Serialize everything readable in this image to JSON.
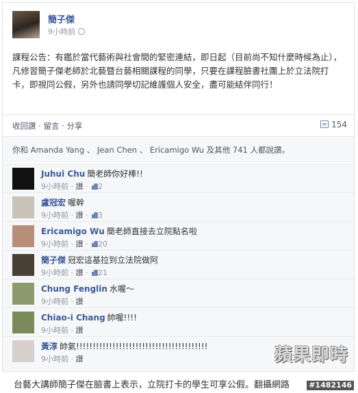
{
  "post": {
    "author": "簡子傑",
    "time": "9小時前",
    "text": "課程公告：有鑑於當代藝術與社會間的緊密連結，即日起（目前尚不知什麼時候為止），凡修習簡子傑老師於北藝暨台藝相關課程的同學，只要在課程臉書社團上於立法院打卡，即視同公假，另外也請同學切記維護個人安全，盡可能結伴同行！"
  },
  "actions": {
    "like": "收回讚",
    "comment": "留言",
    "share": "分享",
    "separator": " · ",
    "share_count": "154"
  },
  "likes": {
    "text": "你和 Amanda Yang 、 Jean Chen 、 Ericamigo Wu 及其他 741 人都說讚。"
  },
  "comments": [
    {
      "name": "Juhui Chu",
      "text": "簡老師你好棒!!",
      "time": "9小時前",
      "like": "讚",
      "likes": "2",
      "avatar_color": "#111111"
    },
    {
      "name": "盧冠宏",
      "text": "喔幹",
      "time": "9小時前",
      "like": "讚",
      "likes": "3",
      "avatar_color": "#c9c2b8"
    },
    {
      "name": "Ericamigo Wu",
      "text": "簡老師直接去立院點名啦",
      "time": "9小時前",
      "like": "讚",
      "likes": "20",
      "avatar_color": "#b88f7a"
    },
    {
      "name": "簡子傑",
      "text": "冠宏這基拉到立法院做阿",
      "time": "9小時前",
      "like": "讚",
      "likes": "21",
      "avatar_color": "#4a3f35"
    },
    {
      "name": "Chung Fenglin",
      "text": "水喔～",
      "time": "9小時前",
      "like": "讚",
      "likes": "",
      "avatar_color": "#8c9a6e"
    },
    {
      "name": "Chiao-i Chang",
      "text": "帥喔!!!!",
      "time": "9小時前",
      "like": "讚",
      "likes": "",
      "avatar_color": "#7a8a5a"
    },
    {
      "name": "黃淳",
      "text": "帥氣!!!!!!!!!!!!!!!!!!!!!!!!!!!!!!!!!!!!!!!!",
      "time": "9小時前",
      "like": "讚",
      "likes": "",
      "avatar_color": "#d8d0cc"
    }
  ],
  "watermark": "蘋果即時",
  "photo_id": "#1482146",
  "caption": "台藝大講師簡子傑在臉書上表示，立院打卡的學生可享公假。翻攝網路"
}
